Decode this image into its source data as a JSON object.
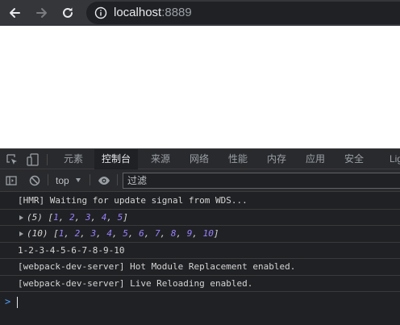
{
  "browser": {
    "url_host": "localhost",
    "url_port": ":8889"
  },
  "devtools": {
    "tabs": [
      "元素",
      "控制台",
      "来源",
      "网络",
      "性能",
      "内存",
      "应用",
      "安全",
      "Lig"
    ],
    "active_tab": "控制台",
    "context": "top",
    "filter_placeholder": "过滤"
  },
  "console": {
    "messages": [
      {
        "text": "[HMR] Waiting for update signal from WDS..."
      },
      {
        "count": "(5)",
        "open": "[",
        "close": "]",
        "values": [
          "1",
          "2",
          "3",
          "4",
          "5"
        ]
      },
      {
        "count": "(10)",
        "open": "[",
        "close": "]",
        "values": [
          "1",
          "2",
          "3",
          "4",
          "5",
          "6",
          "7",
          "8",
          "9",
          "10"
        ]
      },
      {
        "text": "1-2-3-4-5-6-7-8-9-10"
      },
      {
        "text": "[webpack-dev-server] Hot Module Replacement enabled."
      },
      {
        "text": "[webpack-dev-server] Live Reloading enabled."
      }
    ],
    "prompt_symbol": ">"
  },
  "colors": {
    "numbers": "#9980ff",
    "prompt": "#4e9cf5"
  },
  "icons": [
    "back-icon",
    "forward-icon",
    "reload-icon",
    "info-icon",
    "inspect-icon",
    "device-toggle-icon",
    "sidebar-toggle-icon",
    "clear-console-icon",
    "live-expression-icon"
  ]
}
